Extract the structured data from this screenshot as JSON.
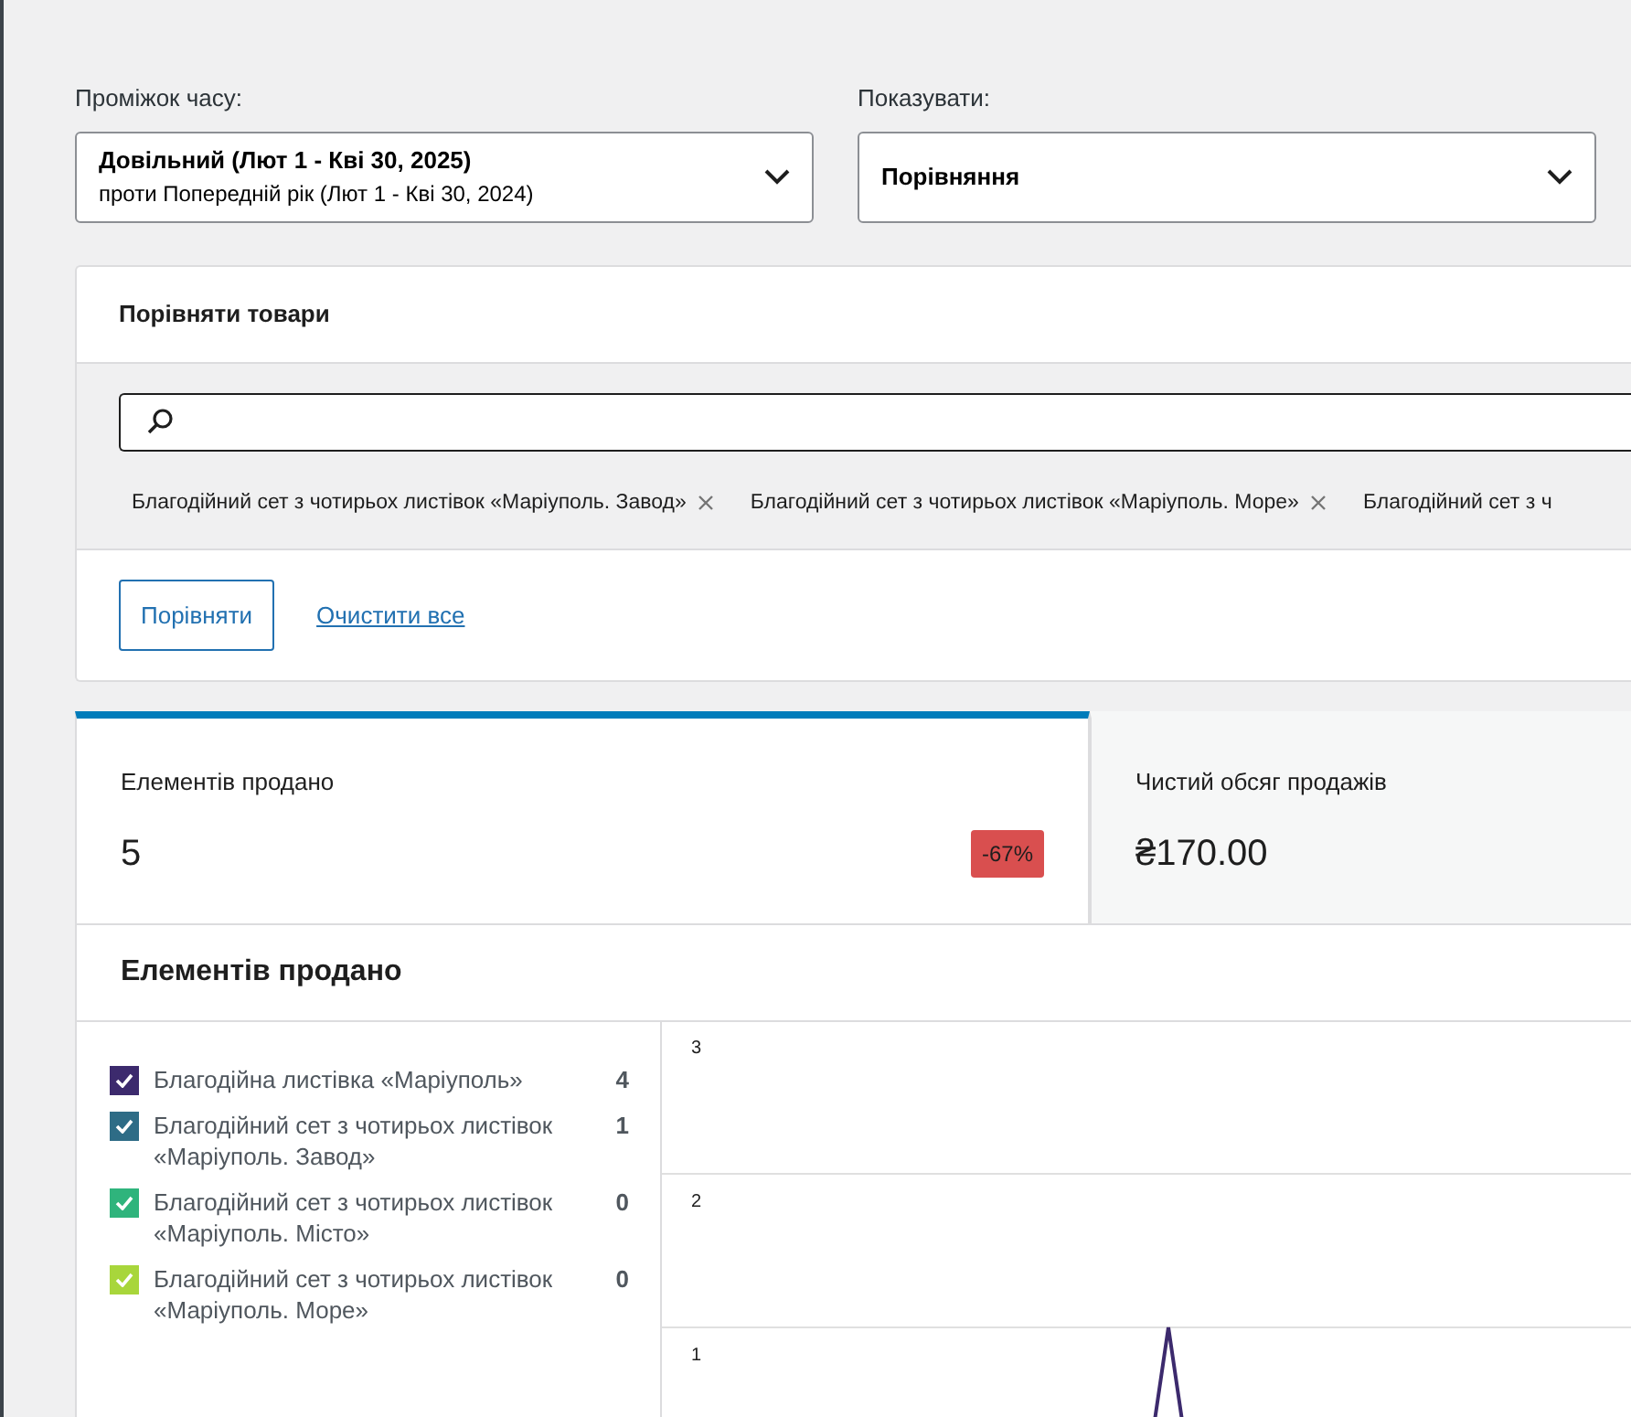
{
  "filters": [
    {
      "label": "Проміжок часу:",
      "value": "Довільний (Лют 1 - Кві 30, 2025)",
      "subvalue": "проти Попередній рік (Лют 1 - Кві 30, 2024)"
    },
    {
      "label": "Показувати:",
      "value": "Порівняння"
    }
  ],
  "compare": {
    "title": "Порівняти товари",
    "chips": [
      {
        "label": "Благодійний сет з чотирьох листівок «Маріуполь. Завод»",
        "removable": true
      },
      {
        "label": "Благодійний сет з чотирьох листівок «Маріуполь. Море»",
        "removable": true
      },
      {
        "label": "Благодійний сет з ч",
        "removable": false
      }
    ],
    "compare_button": "Порівняти",
    "clear_link": "Очистити все"
  },
  "stats": [
    {
      "label": "Елементів продано",
      "value": "5",
      "delta": "-67%",
      "selected": true
    },
    {
      "label": "Чистий обсяг продажів",
      "value": "₴170.00",
      "selected": false
    }
  ],
  "chart_panel": {
    "title": "Елементів продано",
    "legend": [
      {
        "label": "Благодійна листівка «Маріуполь»",
        "value": "4",
        "checked": true,
        "color": "#3c2a6d"
      },
      {
        "label": "Благодійний сет з чотирьох листівок «Маріуполь. Завод»",
        "value": "1",
        "checked": true,
        "color": "#2e6c86"
      },
      {
        "label": "Благодійний сет з чотирьох листівок «Маріуполь. Місто»",
        "value": "0",
        "checked": true,
        "color": "#2fb47c"
      },
      {
        "label": "Благодійний сет з чотирьох листівок «Маріуполь. Море»",
        "value": "0",
        "checked": true,
        "color": "#a8d63b"
      }
    ],
    "y_tick_labels": [
      "3",
      "2",
      "1"
    ]
  }
}
